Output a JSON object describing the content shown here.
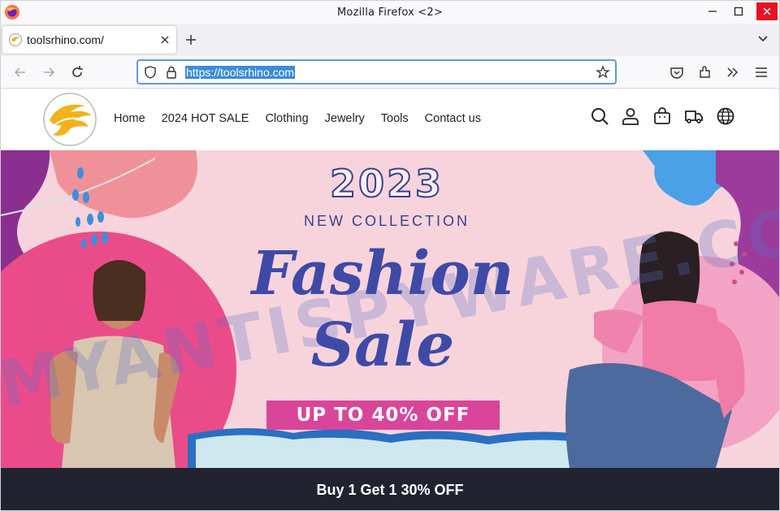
{
  "window": {
    "title": "Mozilla Firefox <2>",
    "icons": [
      "firefox-logo",
      "minimize-icon",
      "maximize-icon",
      "close-icon"
    ]
  },
  "tabs": [
    {
      "label": "toolsrhino.com/",
      "active": true
    }
  ],
  "navbar": {
    "url": "https://toolsrhino.com",
    "icons": [
      "back-icon",
      "forward-icon",
      "reload-icon",
      "shield-icon",
      "lock-icon",
      "bookmark-star-icon",
      "pocket-icon",
      "extensions-icon",
      "overflow-icon",
      "menu-icon"
    ]
  },
  "site": {
    "menu": [
      "Home",
      "2024 HOT SALE",
      "Clothing",
      "Jewelry",
      "Tools",
      "Contact us"
    ],
    "header_icons": [
      "search-icon",
      "account-icon",
      "cart-icon",
      "shipping-truck-icon",
      "globe-icon"
    ]
  },
  "hero": {
    "year": "2023",
    "subtitle": "NEW COLLECTION",
    "headline_1": "Fashion",
    "headline_2": "Sale",
    "offer": "UP TO 40% OFF",
    "watermark": "MYANTISPYWARE.COM"
  },
  "promo": {
    "text": "Buy 1 Get 1 30% OFF"
  },
  "colors": {
    "accent_blue": "#3e4aa6",
    "offer_pink": "#d9459a",
    "hero_bg": "#f7d4dc",
    "promo_bg": "#222330"
  }
}
